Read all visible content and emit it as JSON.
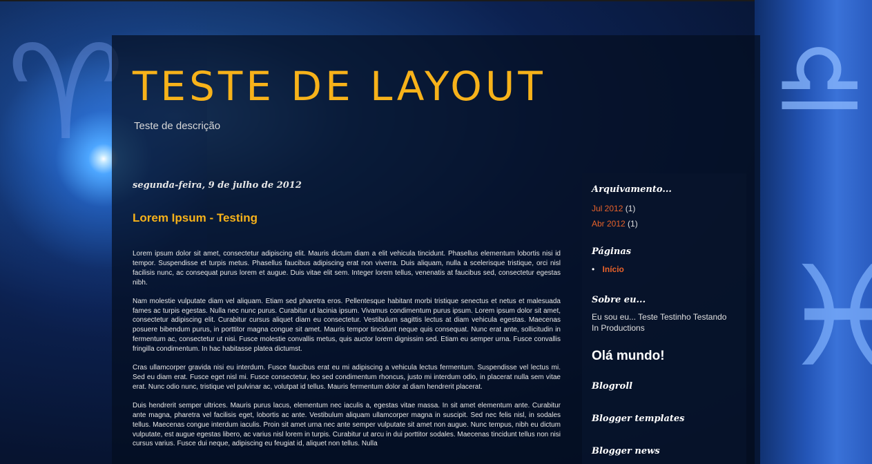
{
  "header": {
    "title": "Teste de Layout",
    "description": "Teste de descrição"
  },
  "post": {
    "date": "segunda-feira, 9 de julho de 2012",
    "title": "Lorem Ipsum - Testing",
    "paragraphs": [
      "Lorem ipsum dolor sit amet, consectetur adipiscing elit. Mauris dictum diam a elit vehicula tincidunt. Phasellus elementum lobortis nisi id tempor. Suspendisse et turpis metus. Phasellus faucibus adipiscing erat non viverra. Duis aliquam, nulla a scelerisque tristique, orci nisl facilisis nunc, ac consequat purus lorem et augue. Duis vitae elit sem. Integer lorem tellus, venenatis at faucibus sed, consectetur egestas nibh.",
      "Nam molestie vulputate diam vel aliquam. Etiam sed pharetra eros. Pellentesque habitant morbi tristique senectus et netus et malesuada fames ac turpis egestas. Nulla nec nunc purus. Curabitur ut lacinia ipsum. Vivamus condimentum purus ipsum. Lorem ipsum dolor sit amet, consectetur adipiscing elit. Curabitur cursus aliquet diam eu consectetur. Vestibulum sagittis lectus at diam vehicula egestas. Maecenas posuere bibendum purus, in porttitor magna congue sit amet. Mauris tempor tincidunt neque quis consequat. Nunc erat ante, sollicitudin in fermentum ac, consectetur ut nisi. Fusce molestie convallis metus, quis auctor lorem dignissim sed. Etiam eu semper urna. Fusce convallis fringilla condimentum. In hac habitasse platea dictumst.",
      "Cras ullamcorper gravida nisi eu interdum. Fusce faucibus erat eu mi adipiscing a vehicula lectus fermentum. Suspendisse vel lectus mi. Sed eu diam erat. Fusce eget nisl mi. Fusce consectetur, leo sed condimentum rhoncus, justo mi interdum odio, in placerat nulla sem vitae erat. Nunc odio nunc, tristique vel pulvinar ac, volutpat id tellus. Mauris fermentum dolor at diam hendrerit placerat.",
      "Duis hendrerit semper ultrices. Mauris purus lacus, elementum nec iaculis a, egestas vitae massa. In sit amet elementum ante. Curabitur ante magna, pharetra vel facilisis eget, lobortis ac ante. Vestibulum aliquam ullamcorper magna in suscipit. Sed nec felis nisl, in sodales tellus. Maecenas congue interdum iaculis. Proin sit amet urna nec ante semper vulputate sit amet non augue. Nunc tempus, nibh eu dictum vulputate, est augue egestas libero, ac varius nisl lorem in turpis. Curabitur ut arcu in dui porttitor sodales. Maecenas tincidunt tellus non nisi cursus varius. Fusce dui neque, adipiscing eu feugiat id, aliquet non tellus. Nulla"
    ]
  },
  "sidebar": {
    "archive_title": "Arquivamento...",
    "archive": [
      {
        "label": "Jul 2012",
        "count": "(1)"
      },
      {
        "label": "Abr 2012",
        "count": "(1)"
      }
    ],
    "pages_title": "Páginas",
    "pages": [
      {
        "label": "Início"
      }
    ],
    "about_title": "Sobre eu...",
    "about_text": "Eu sou eu... Teste Testinho Testando In Productions",
    "hello": "Olá mundo!",
    "blogroll_title": "Blogroll",
    "templates_title": "Blogger templates",
    "news_title": "Blogger news"
  },
  "colors": {
    "accent": "#f7b21a",
    "link": "#e8622a",
    "text": "#e8e8e8"
  }
}
